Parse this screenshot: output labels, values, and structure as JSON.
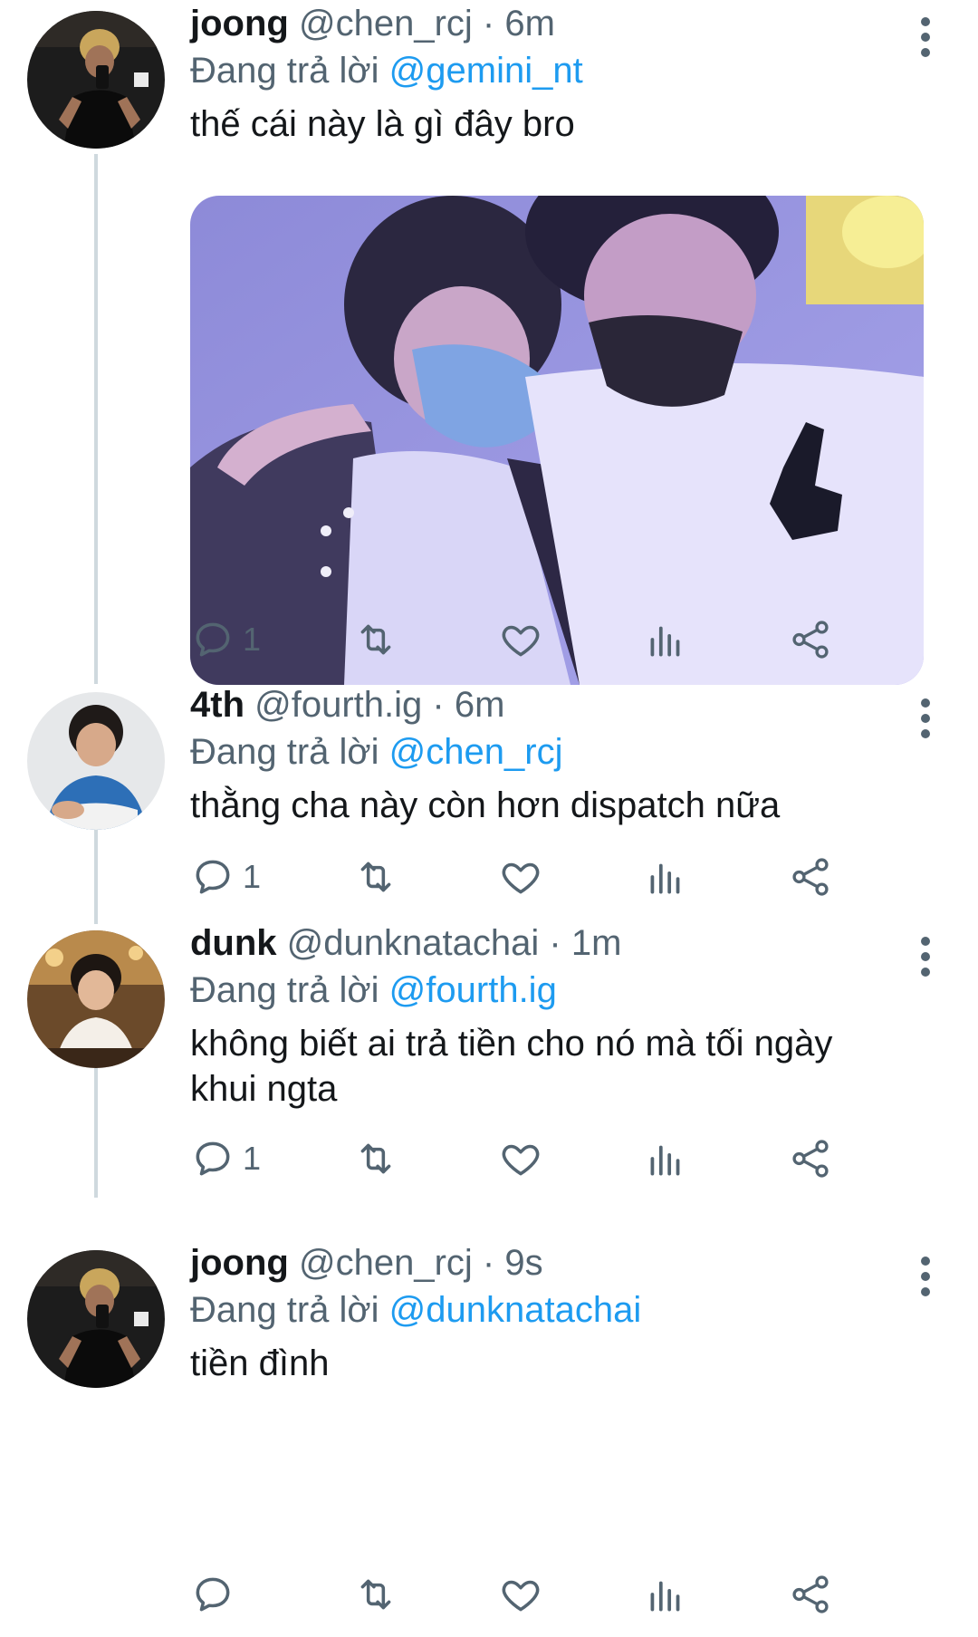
{
  "colors": {
    "link": "#1d9bf0",
    "secondary_text": "#536471",
    "thread_line": "#cfd9de",
    "action_icon": "#536471"
  },
  "reply_prefix": "Đang trả lời",
  "tweets": [
    {
      "display_name": "joong",
      "handle": "@chen_rcj",
      "sep": "·",
      "time": "6m",
      "reply_to": "@gemini_nt",
      "text": "thế cái này là gì đây bro",
      "reply_count": "1",
      "has_media": true,
      "avatar": "man-mirror-selfie-avatar"
    },
    {
      "display_name": "4th",
      "handle": "@fourth.ig",
      "sep": "·",
      "time": "6m",
      "reply_to": "@chen_rcj",
      "text": "thằng cha này còn hơn dispatch nữa",
      "reply_count": "1",
      "has_media": false,
      "avatar": "man-blue-shirt-avatar"
    },
    {
      "display_name": "dunk",
      "handle": "@dunknatachai",
      "sep": "·",
      "time": "1m",
      "reply_to": "@fourth.ig",
      "text": "không biết ai trả tiền cho nó mà tối ngày\nkhui ngta",
      "reply_count": "1",
      "has_media": false,
      "avatar": "man-restaurant-avatar"
    },
    {
      "display_name": "joong",
      "handle": "@chen_rcj",
      "sep": "·",
      "time": "9s",
      "reply_to": "@dunknatachai",
      "text": "tiền đình",
      "reply_count": "",
      "has_media": false,
      "avatar": "man-mirror-selfie-avatar"
    }
  ],
  "icons": {
    "reply": "reply-icon",
    "retweet": "retweet-icon",
    "like": "heart-icon",
    "analytics": "analytics-icon",
    "share": "share-icon",
    "more": "more-vertical-icon"
  }
}
